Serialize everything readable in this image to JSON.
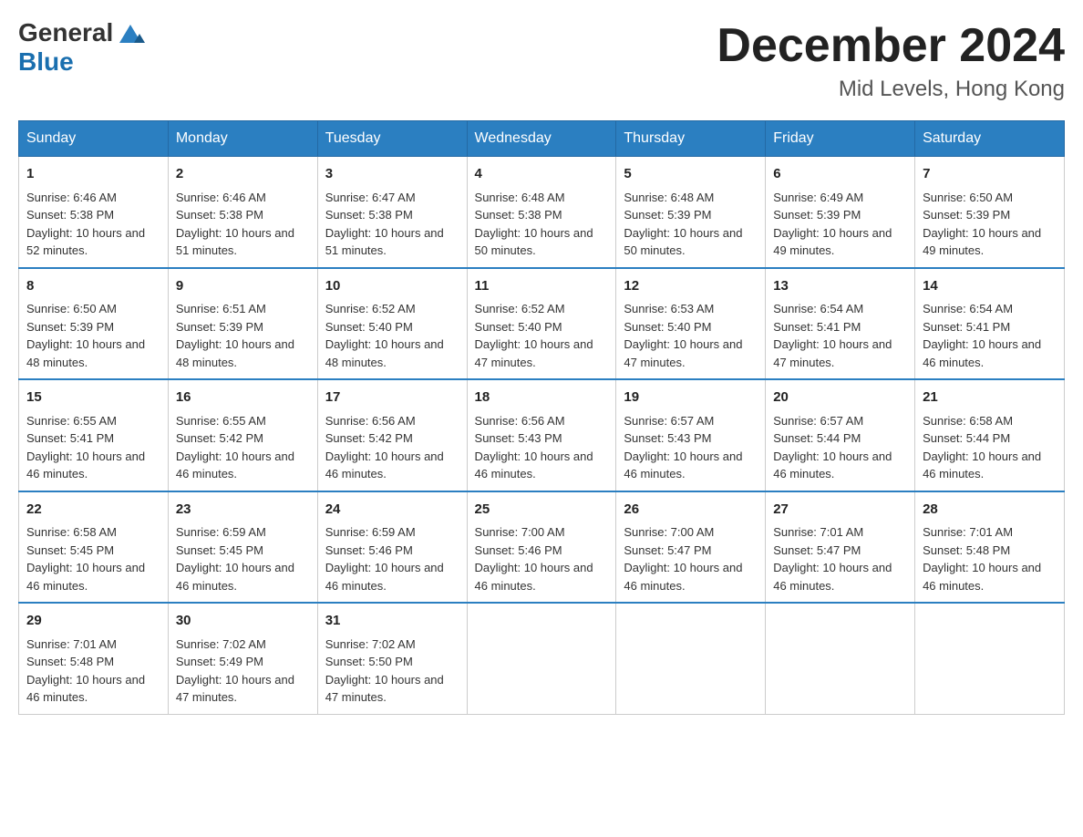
{
  "header": {
    "title": "December 2024",
    "subtitle": "Mid Levels, Hong Kong",
    "logo_general": "General",
    "logo_blue": "Blue"
  },
  "weekdays": [
    "Sunday",
    "Monday",
    "Tuesday",
    "Wednesday",
    "Thursday",
    "Friday",
    "Saturday"
  ],
  "weeks": [
    [
      {
        "day": "1",
        "sunrise": "6:46 AM",
        "sunset": "5:38 PM",
        "daylight": "10 hours and 52 minutes."
      },
      {
        "day": "2",
        "sunrise": "6:46 AM",
        "sunset": "5:38 PM",
        "daylight": "10 hours and 51 minutes."
      },
      {
        "day": "3",
        "sunrise": "6:47 AM",
        "sunset": "5:38 PM",
        "daylight": "10 hours and 51 minutes."
      },
      {
        "day": "4",
        "sunrise": "6:48 AM",
        "sunset": "5:38 PM",
        "daylight": "10 hours and 50 minutes."
      },
      {
        "day": "5",
        "sunrise": "6:48 AM",
        "sunset": "5:39 PM",
        "daylight": "10 hours and 50 minutes."
      },
      {
        "day": "6",
        "sunrise": "6:49 AM",
        "sunset": "5:39 PM",
        "daylight": "10 hours and 49 minutes."
      },
      {
        "day": "7",
        "sunrise": "6:50 AM",
        "sunset": "5:39 PM",
        "daylight": "10 hours and 49 minutes."
      }
    ],
    [
      {
        "day": "8",
        "sunrise": "6:50 AM",
        "sunset": "5:39 PM",
        "daylight": "10 hours and 48 minutes."
      },
      {
        "day": "9",
        "sunrise": "6:51 AM",
        "sunset": "5:39 PM",
        "daylight": "10 hours and 48 minutes."
      },
      {
        "day": "10",
        "sunrise": "6:52 AM",
        "sunset": "5:40 PM",
        "daylight": "10 hours and 48 minutes."
      },
      {
        "day": "11",
        "sunrise": "6:52 AM",
        "sunset": "5:40 PM",
        "daylight": "10 hours and 47 minutes."
      },
      {
        "day": "12",
        "sunrise": "6:53 AM",
        "sunset": "5:40 PM",
        "daylight": "10 hours and 47 minutes."
      },
      {
        "day": "13",
        "sunrise": "6:54 AM",
        "sunset": "5:41 PM",
        "daylight": "10 hours and 47 minutes."
      },
      {
        "day": "14",
        "sunrise": "6:54 AM",
        "sunset": "5:41 PM",
        "daylight": "10 hours and 46 minutes."
      }
    ],
    [
      {
        "day": "15",
        "sunrise": "6:55 AM",
        "sunset": "5:41 PM",
        "daylight": "10 hours and 46 minutes."
      },
      {
        "day": "16",
        "sunrise": "6:55 AM",
        "sunset": "5:42 PM",
        "daylight": "10 hours and 46 minutes."
      },
      {
        "day": "17",
        "sunrise": "6:56 AM",
        "sunset": "5:42 PM",
        "daylight": "10 hours and 46 minutes."
      },
      {
        "day": "18",
        "sunrise": "6:56 AM",
        "sunset": "5:43 PM",
        "daylight": "10 hours and 46 minutes."
      },
      {
        "day": "19",
        "sunrise": "6:57 AM",
        "sunset": "5:43 PM",
        "daylight": "10 hours and 46 minutes."
      },
      {
        "day": "20",
        "sunrise": "6:57 AM",
        "sunset": "5:44 PM",
        "daylight": "10 hours and 46 minutes."
      },
      {
        "day": "21",
        "sunrise": "6:58 AM",
        "sunset": "5:44 PM",
        "daylight": "10 hours and 46 minutes."
      }
    ],
    [
      {
        "day": "22",
        "sunrise": "6:58 AM",
        "sunset": "5:45 PM",
        "daylight": "10 hours and 46 minutes."
      },
      {
        "day": "23",
        "sunrise": "6:59 AM",
        "sunset": "5:45 PM",
        "daylight": "10 hours and 46 minutes."
      },
      {
        "day": "24",
        "sunrise": "6:59 AM",
        "sunset": "5:46 PM",
        "daylight": "10 hours and 46 minutes."
      },
      {
        "day": "25",
        "sunrise": "7:00 AM",
        "sunset": "5:46 PM",
        "daylight": "10 hours and 46 minutes."
      },
      {
        "day": "26",
        "sunrise": "7:00 AM",
        "sunset": "5:47 PM",
        "daylight": "10 hours and 46 minutes."
      },
      {
        "day": "27",
        "sunrise": "7:01 AM",
        "sunset": "5:47 PM",
        "daylight": "10 hours and 46 minutes."
      },
      {
        "day": "28",
        "sunrise": "7:01 AM",
        "sunset": "5:48 PM",
        "daylight": "10 hours and 46 minutes."
      }
    ],
    [
      {
        "day": "29",
        "sunrise": "7:01 AM",
        "sunset": "5:48 PM",
        "daylight": "10 hours and 46 minutes."
      },
      {
        "day": "30",
        "sunrise": "7:02 AM",
        "sunset": "5:49 PM",
        "daylight": "10 hours and 47 minutes."
      },
      {
        "day": "31",
        "sunrise": "7:02 AM",
        "sunset": "5:50 PM",
        "daylight": "10 hours and 47 minutes."
      },
      null,
      null,
      null,
      null
    ]
  ],
  "labels": {
    "sunrise": "Sunrise:",
    "sunset": "Sunset:",
    "daylight": "Daylight:"
  }
}
